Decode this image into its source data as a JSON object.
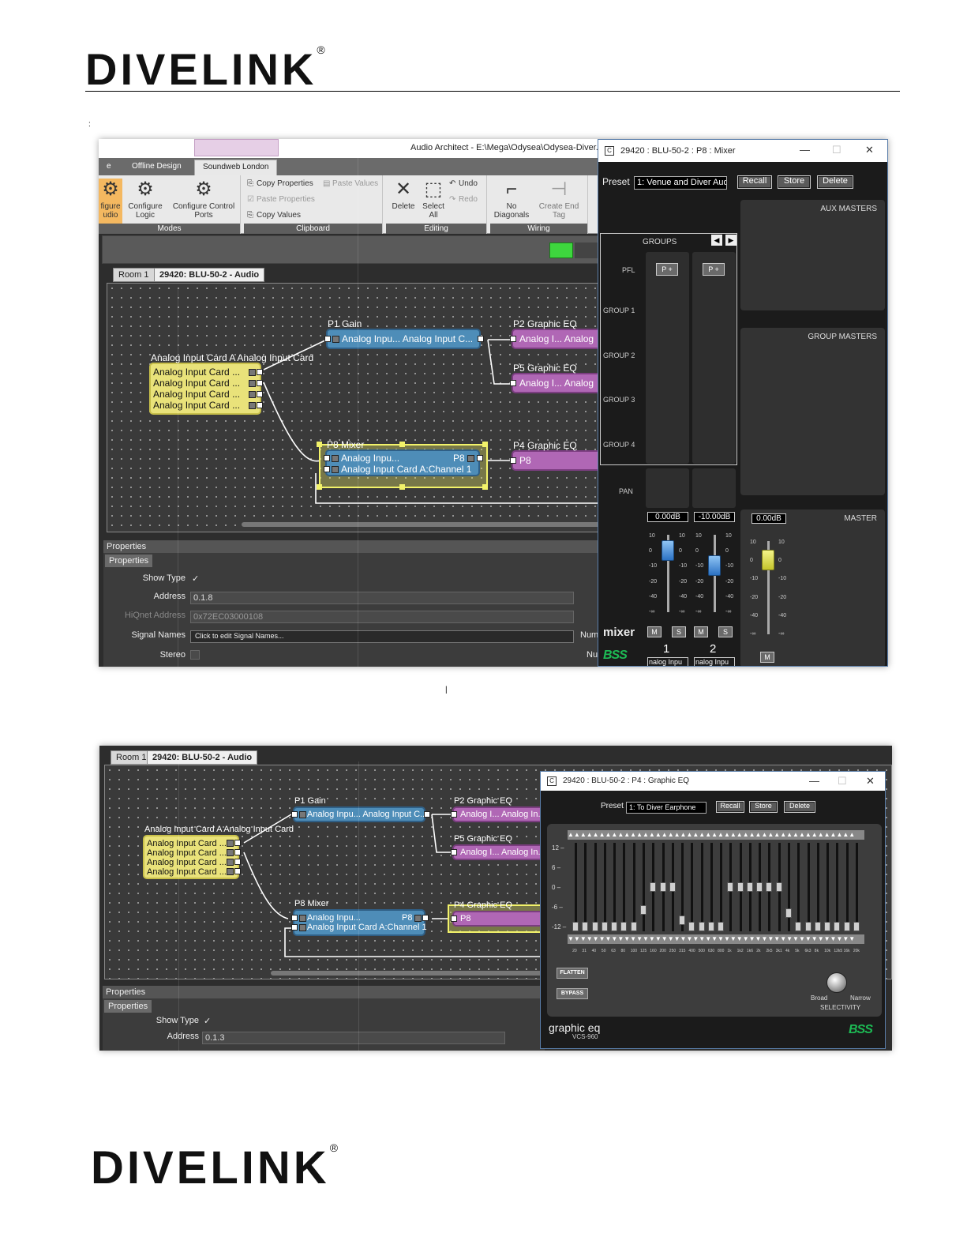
{
  "doc": {
    "logo_text": "DIVELINK",
    "logo_reg": "®",
    "stray_mark": ":",
    "gap_mark": "|"
  },
  "shot1": {
    "app_title": "Audio Architect - E:\\Mega\\Odysea\\Odysea-Diver...",
    "tabs": {
      "prev": "e",
      "offline": "Offline Design",
      "soundweb": "Soundweb London"
    },
    "ribbon": {
      "modes": {
        "label": "Modes",
        "partial": "figure\nudio",
        "configure_logic": "Configure\nLogic",
        "configure_ports": "Configure Control\nPorts"
      },
      "clipboard": {
        "label": "Clipboard",
        "copy_properties": "Copy Properties",
        "paste_values": "Paste Values",
        "paste_properties": "Paste Properties",
        "copy_values": "Copy Values"
      },
      "editing": {
        "label": "Editing",
        "delete": "Delete",
        "select_all": "Select\nAll",
        "undo": "Undo",
        "redo": "Redo"
      },
      "wiring": {
        "label": "Wiring",
        "no_diagonals": "No\nDiagonals",
        "create_end_tag": "Create End\nTag"
      }
    },
    "doc_tabs": {
      "room": "Room 1",
      "device": "29420: BLU-50-2 - Audio"
    },
    "blocks": {
      "card": {
        "caption": "Analog Input Card A  Analog Input Card",
        "rows": [
          "Analog Input Card ...",
          "Analog Input Card ...",
          "Analog Input Card ...",
          "Analog Input Card ..."
        ]
      },
      "gain": {
        "caption": "P1  Gain",
        "row": "Analog Inpu... Analog Input C..."
      },
      "eq2": {
        "caption": "P2  Graphic EQ",
        "row": "Analog I...  Analog"
      },
      "eq5": {
        "caption": "P5  Graphic EQ",
        "row": "Analog I...  Analog"
      },
      "mixer": {
        "caption": "P8  Mixer",
        "row1a": "Analog Inpu...",
        "row1b": "P8",
        "row2": "Analog Input Card A:Channel 1"
      },
      "eq4": {
        "caption": "P4  Graphic EQ",
        "row": "P8"
      }
    },
    "props": {
      "head": "Properties",
      "sub": "Properties",
      "show_type": "Show Type",
      "check": "✓",
      "address_lbl": "Address",
      "address_val": "0.1.8",
      "hiqnet_lbl": "HiQnet Address",
      "hiqnet_val": "0x72EC03000108",
      "signal_lbl": "Signal Names",
      "signal_btn": "Click to edit Signal Names...",
      "stereo_lbl": "Stereo",
      "num1": "Num",
      "num2": "Nu"
    },
    "mixer_win": {
      "title": "29420 : BLU-50-2 : P8 : Mixer",
      "preset_lbl": "Preset",
      "preset_val": "1: Venue and Diver Audi",
      "recall": "Recall",
      "store": "Store",
      "delete": "Delete",
      "groups": "GROUPS",
      "aux_masters": "AUX MASTERS",
      "group_masters": "GROUP MASTERS",
      "master": "MASTER",
      "rows": {
        "pfl": "PFL",
        "g1": "GROUP 1",
        "g2": "GROUP 2",
        "g3": "GROUP 3",
        "g4": "GROUP 4",
        "pan": "PAN"
      },
      "pfl_btn": "P +",
      "ch1": {
        "db": "0.00dB",
        "num": "1",
        "name": "nalog Inpu",
        "level_db": 0
      },
      "ch2": {
        "db": "-10.00dB",
        "num": "2",
        "name": "nalog Inpu",
        "level_db": -10
      },
      "master_ch": {
        "db": "0.00dB",
        "level_db": 0
      },
      "ticks": [
        "10",
        "0",
        "-10",
        "-20",
        "-40",
        "-∞"
      ],
      "mute": "M",
      "solo": "S",
      "brand": "mixer",
      "bss": "BSS"
    }
  },
  "shot2": {
    "doc_tabs": {
      "room": "Room 1",
      "device": "29420: BLU-50-2 - Audio"
    },
    "blocks": {
      "card": {
        "caption": "Analog Input Card A  Analog Input Card",
        "rows": [
          "Analog Input Card ...",
          "Analog Input Card ...",
          "Analog Input Card ...",
          "Analog Input Card ..."
        ]
      },
      "gain": {
        "caption": "P1  Gain",
        "row": "Analog Inpu... Analog Input C..."
      },
      "eq2": {
        "caption": "P2  Graphic EQ",
        "row": "Analog I...  Analog In..."
      },
      "eq5": {
        "caption": "P5  Graphic EQ",
        "row": "Analog I...  Analog In..."
      },
      "mixer": {
        "caption": "P8  Mixer",
        "row1a": "Analog Inpu...",
        "row1b": "P8",
        "row2": "Analog Input Card A:Channel 1"
      },
      "eq4": {
        "caption": "P4  Graphic EQ",
        "row": "P8"
      }
    },
    "props": {
      "head": "Properties",
      "sub": "Properties",
      "show_type": "Show Type",
      "check": "✓",
      "address_lbl": "Address",
      "address_val": "0.1.3"
    },
    "eq_win": {
      "title": "29420 : BLU-50-2 : P4 : Graphic EQ",
      "preset_lbl": "Preset",
      "preset_val": "1: To Diver Earphone",
      "recall": "Recall",
      "store": "Store",
      "delete": "Delete",
      "scale": [
        "12",
        "6",
        "0",
        "-6",
        "-12"
      ],
      "freqs": [
        "20",
        "31",
        "40",
        "50",
        "63",
        "80",
        "100",
        "125",
        "160",
        "200",
        "250",
        "315",
        "400",
        "500",
        "630",
        "800",
        "1k",
        "1k2",
        "1k6",
        "2k",
        "2k5",
        "3k1",
        "4k",
        "5k",
        "6k3",
        "8k",
        "10k",
        "12k5",
        "16k",
        "20k"
      ],
      "bands_db": [
        -12,
        -12,
        -12,
        -12,
        -12,
        -12,
        -12,
        -7,
        0,
        0,
        0,
        -10,
        -12,
        -12,
        -12,
        -12,
        0,
        0,
        0,
        0,
        0,
        0,
        -8,
        -12,
        -12,
        -12,
        -12,
        -12,
        -12,
        -12
      ],
      "flatten": "FLATTEN",
      "bypass": "BYPASS",
      "broad": "Broad",
      "narrow": "Narrow",
      "selectivity": "SELECTIVITY",
      "brand": "graphic eq",
      "model": "VCS-960",
      "bss": "BSS"
    }
  }
}
